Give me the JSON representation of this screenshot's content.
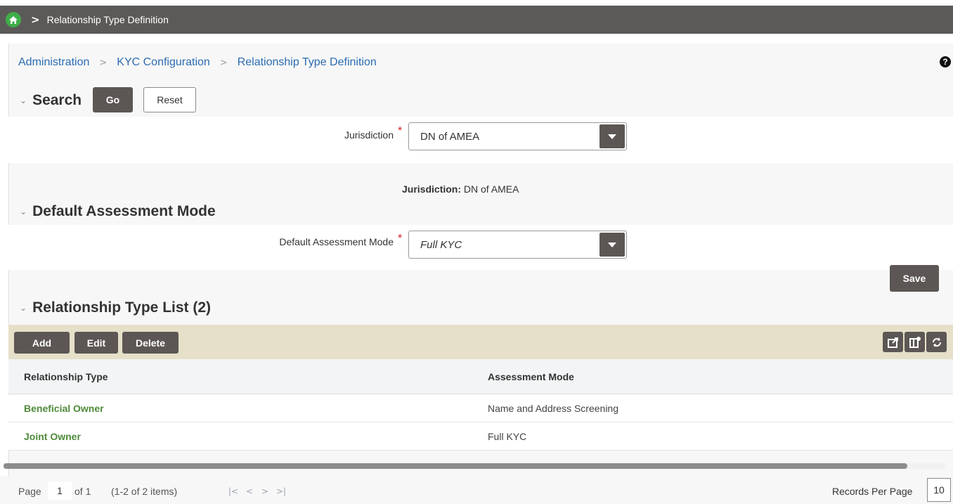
{
  "topbar": {
    "title": "Relationship Type Definition",
    "home_icon": "home-icon",
    "chevron": ">"
  },
  "breadcrumb": {
    "items": [
      "Administration",
      "KYC Configuration",
      "Relationship Type Definition"
    ],
    "separator": ">"
  },
  "help": {
    "glyph": "?"
  },
  "search": {
    "title": "Search",
    "go_label": "Go",
    "reset_label": "Reset",
    "jurisdiction_label": "Jurisdiction",
    "jurisdiction_value": "DN of AMEA",
    "required_mark": "*"
  },
  "summary": {
    "label": "Jurisdiction:",
    "value": "DN of AMEA"
  },
  "assessment": {
    "title": "Default Assessment Mode",
    "field_label": "Default Assessment Mode",
    "field_value": "Full KYC",
    "required_mark": "*",
    "save_label": "Save"
  },
  "list": {
    "title": "Relationship Type List (2)",
    "add_label": "Add",
    "edit_label": "Edit",
    "delete_label": "Delete",
    "columns": [
      "Relationship Type",
      "Assessment Mode"
    ],
    "rows": [
      {
        "type": "Beneficial Owner",
        "mode": "Name and Address Screening"
      },
      {
        "type": "Joint Owner",
        "mode": "Full KYC"
      }
    ],
    "tool_icons": [
      "export-icon",
      "column-settings-icon",
      "refresh-icon"
    ]
  },
  "pager": {
    "page_label": "Page",
    "page": "1",
    "of_label": "of 1",
    "items_label": "(1-2 of 2 items)",
    "nav": [
      "|<",
      "<",
      ">",
      ">|"
    ],
    "rpp_label": "Records Per Page",
    "rpp_value": "10"
  },
  "colors": {
    "topbar": "#5c5a58",
    "accent": "#3fae49",
    "link": "#2b6cb0",
    "row_link": "#4e8a3a",
    "toolbar": "#e6e0c9"
  }
}
